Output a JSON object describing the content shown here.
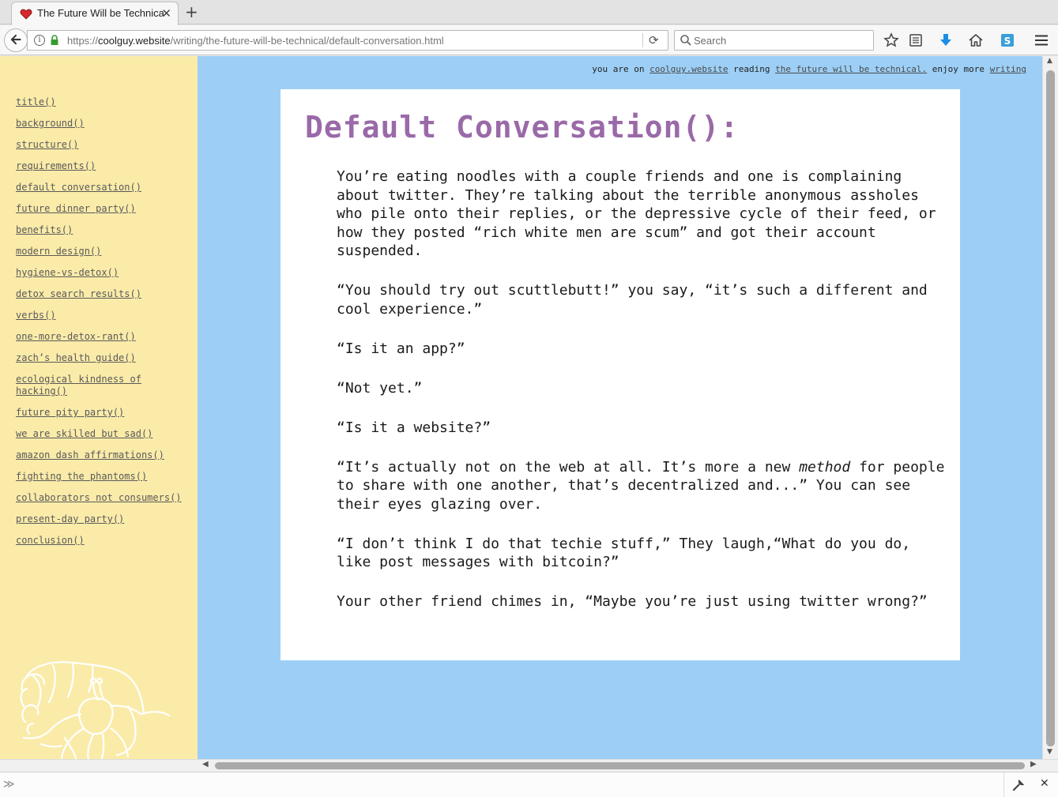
{
  "browser": {
    "tab_title": "The Future Will be Technical",
    "tab_close_glyph": "✕",
    "new_tab_glyph": "+",
    "url_prefix": "https://",
    "url_domain": "coolguy.website",
    "url_path": "/writing/the-future-will-be-technical/default-conversation.html",
    "search_placeholder": "Search",
    "accent_download": "#1d8ee6"
  },
  "page": {
    "topline": {
      "you_are_on": "you are on",
      "site_link": "coolguy.website",
      "reading": "reading",
      "reading_link": "the future will be technical.",
      "enjoy_more": "enjoy more",
      "writing_link": "writing"
    },
    "toc": [
      "title()",
      "background()",
      "structure()",
      "requirements()",
      "default conversation()",
      "future dinner party()",
      "benefits()",
      "modern design()",
      "hygiene-vs-detox()",
      "detox search results()",
      "verbs()",
      "one-more-detox-rant()",
      "zach’s health guide()",
      "ecological kindness of hacking()",
      "future pity party()",
      "we are skilled but sad()",
      "amazon dash affirmations()",
      "fighting the phantoms()",
      "collaborators not consumers()",
      "present-day party()",
      "conclusion()"
    ],
    "heading": "Default Conversation():",
    "paragraphs": [
      "You’re eating noodles with a couple friends and one is complaining about twitter. They’re talking about the terrible anonymous assholes who pile onto their replies, or the depressive cycle of their feed, or how they posted “rich white men are scum” and got their account suspended.",
      "“You should try out scuttlebutt!” you say, “it’s such a different and cool experience.”",
      "“Is it an app?”",
      "“Not yet.”",
      "“Is it a website?”",
      "“I don’t think I do that techie stuff,” They laugh,“What do you do, like post messages with bitcoin?”",
      "Your other friend chimes in, “Maybe you’re just using twitter wrong?”"
    ],
    "method_paragraph": {
      "before": "“It’s actually not on the web at all. It’s more a new ",
      "em": "method",
      "after": " for people to share with one another, that’s decentralized and...” You can see their eyes glazing over."
    },
    "colors": {
      "sidebar_bg": "#faeba9",
      "page_bg": "#9dcff6",
      "heading": "#9a6aa8"
    }
  },
  "devtools": {
    "prompt_glyph": "≫",
    "close_glyph": "✕"
  }
}
